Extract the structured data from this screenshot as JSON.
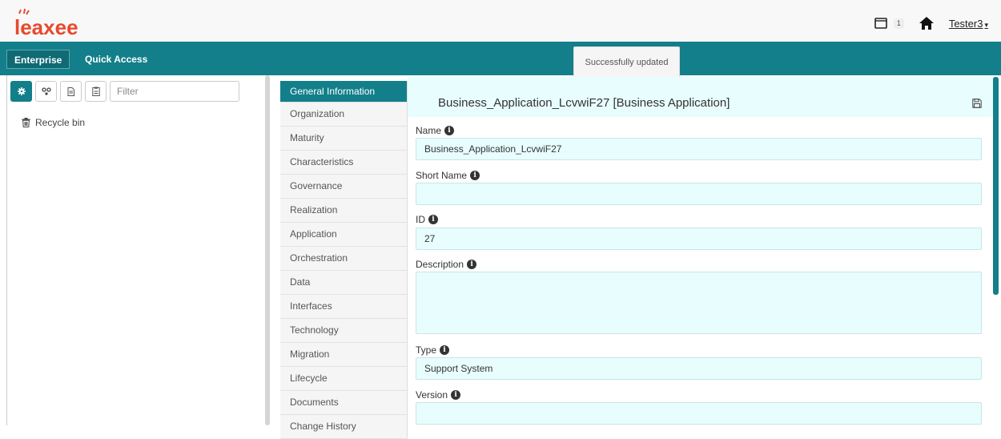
{
  "header": {
    "logo_text": "leaxee",
    "badge_count": "1",
    "user": "Tester3"
  },
  "nav": {
    "tabs": [
      {
        "label": "Enterprise"
      },
      {
        "label": "Quick Access"
      }
    ],
    "toast": "Successfully updated"
  },
  "tree": {
    "filter_placeholder": "Filter",
    "items": [
      {
        "label": "Recycle bin"
      }
    ]
  },
  "sections": [
    {
      "label": "General Information",
      "active": true
    },
    {
      "label": "Organization"
    },
    {
      "label": "Maturity"
    },
    {
      "label": "Characteristics"
    },
    {
      "label": "Governance"
    },
    {
      "label": "Realization"
    },
    {
      "label": "Application"
    },
    {
      "label": "Orchestration"
    },
    {
      "label": "Data"
    },
    {
      "label": "Interfaces"
    },
    {
      "label": "Technology"
    },
    {
      "label": "Migration"
    },
    {
      "label": "Lifecycle"
    },
    {
      "label": "Documents"
    },
    {
      "label": "Change History"
    }
  ],
  "record": {
    "title": "Business_Application_LcvwiF27 [Business Application]",
    "fields": {
      "name": {
        "label": "Name",
        "value": "Business_Application_LcvwiF27"
      },
      "short_name": {
        "label": "Short Name",
        "value": ""
      },
      "id": {
        "label": "ID",
        "value": "27"
      },
      "description": {
        "label": "Description",
        "value": ""
      },
      "type": {
        "label": "Type",
        "value": "Support System"
      },
      "version": {
        "label": "Version",
        "value": ""
      }
    }
  },
  "colors": {
    "brand": "#137f8a",
    "field_bg": "#e8fdfd"
  },
  "icons": [
    "notebook-icon",
    "home-icon",
    "gear-icon",
    "network-icon",
    "document-icon",
    "clipboard-icon",
    "trash-icon",
    "save-icon",
    "info-icon"
  ]
}
